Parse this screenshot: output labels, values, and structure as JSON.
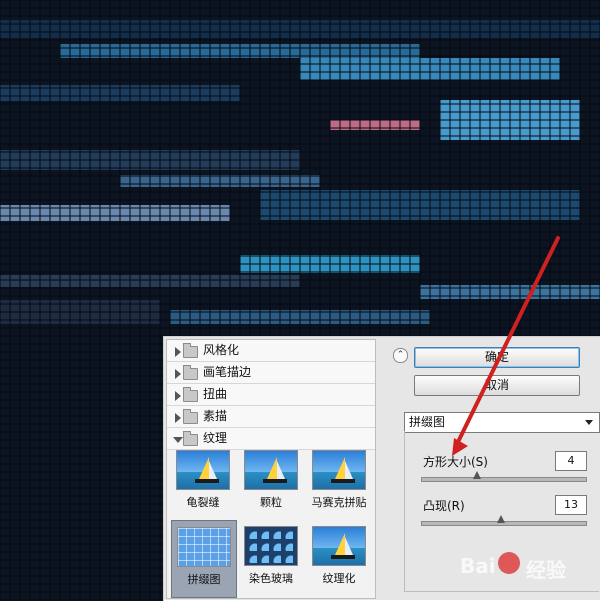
{
  "filters_panel": {
    "categories": [
      {
        "label": "风格化",
        "open": false
      },
      {
        "label": "画笔描边",
        "open": false
      },
      {
        "label": "扭曲",
        "open": false
      },
      {
        "label": "素描",
        "open": false
      },
      {
        "label": "纹理",
        "open": true
      }
    ],
    "texture_filters": [
      {
        "label": "龟裂缝",
        "icon": "seascape-thumbnail"
      },
      {
        "label": "颗粒",
        "icon": "seascape-thumbnail"
      },
      {
        "label": "马赛克拼贴",
        "icon": "seascape-thumbnail"
      },
      {
        "label": "拼缀图",
        "icon": "tile-thumbnail",
        "selected": true
      },
      {
        "label": "染色玻璃",
        "icon": "glass-thumbnail"
      },
      {
        "label": "纹理化",
        "icon": "seascape-thumbnail"
      }
    ]
  },
  "right_panel": {
    "ok_label": "确定",
    "cancel_label": "取消",
    "selected_filter": "拼缀图",
    "params": {
      "square_size": {
        "label": "方形大小(S)",
        "value": "4"
      },
      "relief": {
        "label": "凸现(R)",
        "value": "13"
      }
    }
  },
  "watermark": {
    "left": "Bai",
    "right": "经验"
  },
  "colors": {
    "panel_bg": "#e6e6e6",
    "arrow": "#d02020",
    "accent": "#3c7fb1"
  }
}
